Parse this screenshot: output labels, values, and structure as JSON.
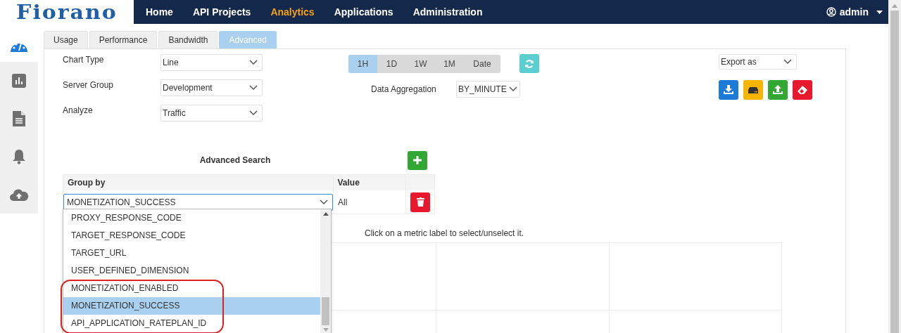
{
  "logo": "Fiorano",
  "nav": [
    {
      "label": "Home",
      "selected": false
    },
    {
      "label": "API Projects",
      "selected": false
    },
    {
      "label": "Analytics",
      "selected": true
    },
    {
      "label": "Applications",
      "selected": false
    },
    {
      "label": "Administration",
      "selected": false
    }
  ],
  "user": {
    "name": "admin"
  },
  "sidebar": {
    "items": [
      {
        "kind": "gauge",
        "selected": true
      },
      {
        "kind": "chart",
        "selected": false
      },
      {
        "kind": "document",
        "selected": false
      },
      {
        "kind": "bell",
        "selected": false
      },
      {
        "kind": "cloud",
        "selected": false
      }
    ]
  },
  "tabs": [
    {
      "label": "Usage",
      "selected": false
    },
    {
      "label": "Performance",
      "selected": false
    },
    {
      "label": "Bandwidth",
      "selected": false
    },
    {
      "label": "Advanced",
      "selected": true
    }
  ],
  "fields": [
    {
      "label": "Chart Type",
      "value": "Line"
    },
    {
      "label": "Server Group",
      "value": "Development"
    },
    {
      "label": "Analyze",
      "value": "Traffic"
    }
  ],
  "time_range": [
    {
      "label": "1H",
      "selected": true
    },
    {
      "label": "1D",
      "selected": false
    },
    {
      "label": "1W",
      "selected": false
    },
    {
      "label": "1M",
      "selected": false
    },
    {
      "label": "Date",
      "selected": false
    }
  ],
  "data_aggregation": {
    "label": "Data Aggregation",
    "value": "BY_MINUTE"
  },
  "export": {
    "value": "Export as"
  },
  "export_buttons": [
    {
      "kind": "download"
    },
    {
      "kind": "drive"
    },
    {
      "kind": "upload"
    },
    {
      "kind": "erase"
    }
  ],
  "advanced_search": {
    "title": "Advanced Search",
    "columns": [
      "Group by",
      "Value"
    ],
    "rows": [
      {
        "group_by": "MONETIZATION_SUCCESS",
        "value": "All"
      }
    ],
    "dropdown": {
      "options": [
        {
          "label": "PROXY_RESPONSE_CODE",
          "selected": false,
          "highlighted": false
        },
        {
          "label": "TARGET_RESPONSE_CODE",
          "selected": false,
          "highlighted": false
        },
        {
          "label": "TARGET_URL",
          "selected": false,
          "highlighted": false
        },
        {
          "label": "USER_DEFINED_DIMENSION",
          "selected": false,
          "highlighted": false
        },
        {
          "label": "MONETIZATION_ENABLED",
          "selected": false,
          "highlighted": true
        },
        {
          "label": "MONETIZATION_SUCCESS",
          "selected": true,
          "highlighted": true
        },
        {
          "label": "API_APPLICATION_RATEPLAN_ID",
          "selected": false,
          "highlighted": true
        }
      ]
    }
  },
  "hint": "Click on a metric label to select/unselect it."
}
